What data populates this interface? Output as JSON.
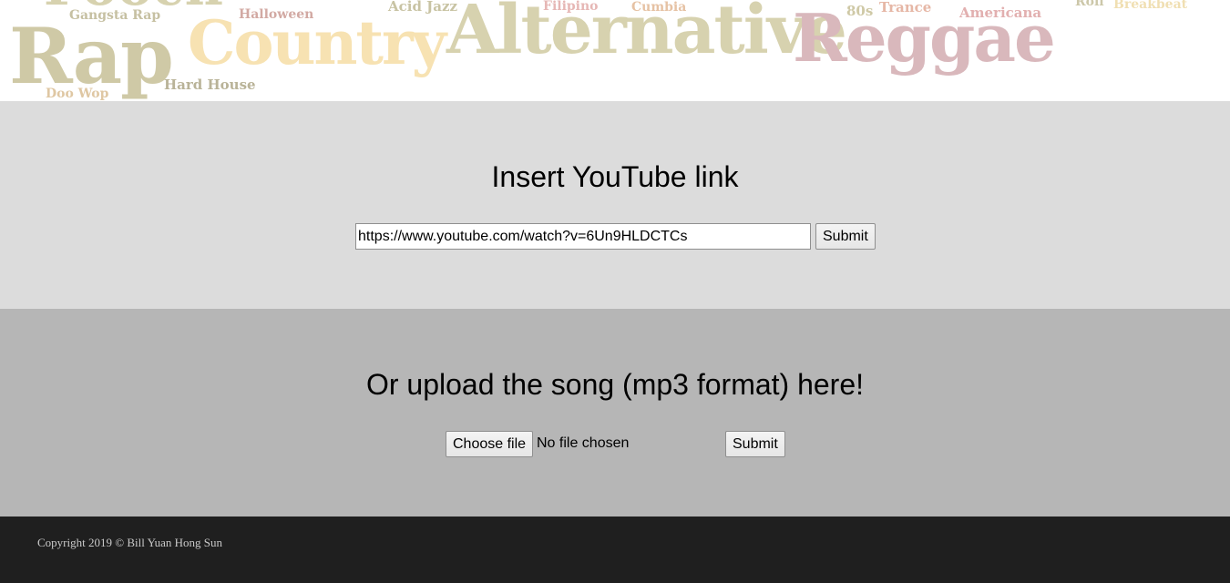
{
  "banner": {
    "words": {
      "rap": "Rap",
      "country": "Country",
      "alternative": "Alternative",
      "reggae": "Reggae",
      "gangsta_rap": "Gangsta Rap",
      "halloween": "Halloween",
      "acid_jazz": "Acid Jazz",
      "filipino": "Filipino",
      "cumbia": "Cumbia",
      "eighties": "80s",
      "trance": "Trance",
      "americana": "Americana",
      "roll": "Roll",
      "breakbeat": "Breakbeat",
      "hard_house": "Hard House",
      "doo_wop": "Doo Wop"
    }
  },
  "youtube": {
    "heading": "Insert YouTube link",
    "url_value": "https://www.youtube.com/watch?v=6Un9HLDCTCs",
    "submit_label": "Submit"
  },
  "upload": {
    "heading": "Or upload the song (mp3 format) here!",
    "choose_label": "Choose file",
    "file_status": "No file chosen",
    "submit_label": "Submit"
  },
  "footer": {
    "copyright": "Copyright 2019 © Bill Yuan Hong Sun"
  }
}
